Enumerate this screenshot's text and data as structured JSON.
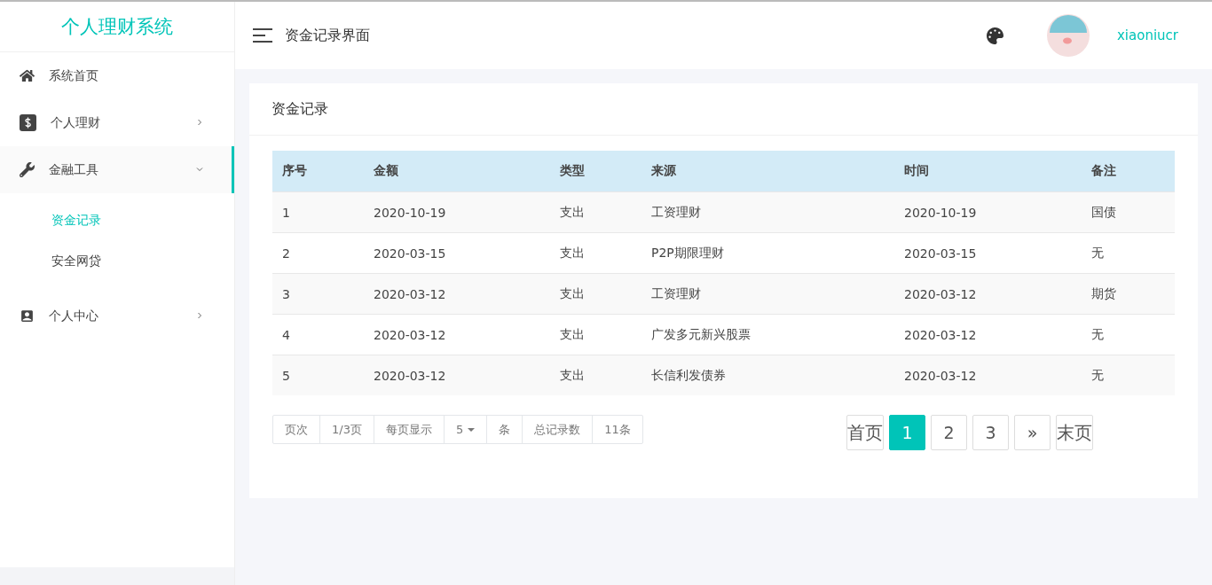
{
  "sidebar": {
    "title": "个人理财系统",
    "items": [
      {
        "label": "系统首页",
        "active": false
      },
      {
        "label": "个人理财",
        "expanded": false,
        "active": false
      },
      {
        "label": "金融工具",
        "expanded": true,
        "active": true,
        "children": [
          {
            "label": "资金记录",
            "selected": true
          },
          {
            "label": "安全网贷",
            "selected": false
          }
        ]
      },
      {
        "label": "个人中心",
        "expanded": false,
        "active": false
      }
    ]
  },
  "header": {
    "title": "资金记录界面",
    "username": "xiaoniucr"
  },
  "card": {
    "title": "资金记录"
  },
  "table": {
    "columns": [
      "序号",
      "金额",
      "类型",
      "来源",
      "时间",
      "备注"
    ],
    "rows": [
      [
        "1",
        "2020-10-19",
        "支出",
        "工资理财",
        "2020-10-19",
        "国债"
      ],
      [
        "2",
        "2020-03-15",
        "支出",
        "P2P期限理财",
        "2020-03-15",
        "无"
      ],
      [
        "3",
        "2020-03-12",
        "支出",
        "工资理财",
        "2020-03-12",
        "期货"
      ],
      [
        "4",
        "2020-03-12",
        "支出",
        "广发多元新兴股票",
        "2020-03-12",
        "无"
      ],
      [
        "5",
        "2020-03-12",
        "支出",
        "长信利发债券",
        "2020-03-12",
        "无"
      ]
    ]
  },
  "pager_info": [
    {
      "kind": "text",
      "label": "页次"
    },
    {
      "kind": "text",
      "label": "1/3页"
    },
    {
      "kind": "text",
      "label": "每页显示"
    },
    {
      "kind": "dropdown",
      "label": "5"
    },
    {
      "kind": "text",
      "label": "条"
    },
    {
      "kind": "text",
      "label": "总记录数"
    },
    {
      "kind": "text",
      "label": "11条"
    }
  ],
  "pagination": [
    {
      "label": "首页",
      "kind": "word",
      "selected": false
    },
    {
      "label": "1",
      "kind": "page",
      "selected": true
    },
    {
      "label": "2",
      "kind": "page",
      "selected": false
    },
    {
      "label": "3",
      "kind": "page",
      "selected": false
    },
    {
      "label": "»",
      "kind": "page",
      "selected": false
    },
    {
      "label": "末页",
      "kind": "word",
      "selected": false
    }
  ]
}
